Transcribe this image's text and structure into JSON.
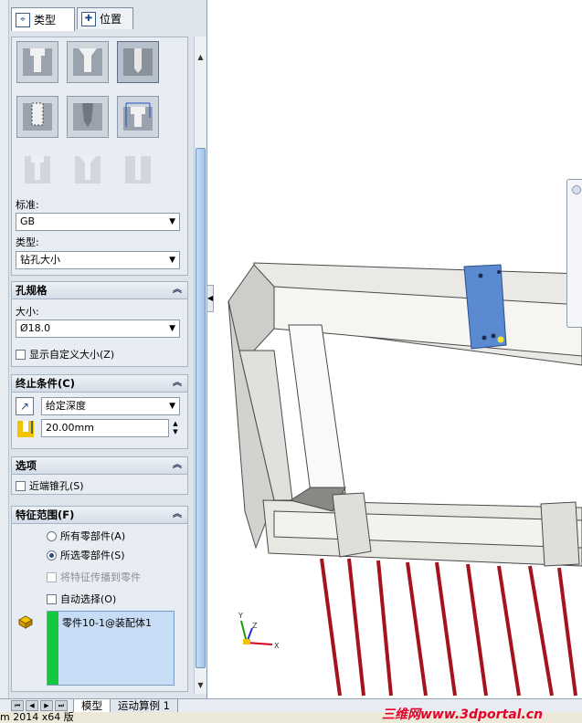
{
  "tabs": {
    "type_label": "类型",
    "position_label": "位置"
  },
  "hole_type": {
    "standard_label": "标准:",
    "standard_value": "GB",
    "type_label": "类型:",
    "type_value": "钻孔大小"
  },
  "hole_spec": {
    "title": "孔规格",
    "size_label": "大小:",
    "size_value": "Ø18.0",
    "custom_size_label": "显示自定义大小(Z)"
  },
  "end_condition": {
    "title": "终止条件(C)",
    "mode_value": "给定深度",
    "depth_value": "20.00mm"
  },
  "options": {
    "title": "选项",
    "near_side_csk_label": "近端锥孔(S)"
  },
  "feature_scope": {
    "title": "特征范围(F)",
    "all_parts_label": "所有零部件(A)",
    "selected_parts_label": "所选零部件(S)",
    "propagate_label": "将特征传播到零件",
    "auto_select_label": "自动选择(O)",
    "selected_item": "零件10-1@装配体1"
  },
  "bottom_tabs": {
    "model_label": "模型",
    "motion_label": "运动算例 1"
  },
  "status": {
    "version_text": "m 2014 x64 版"
  },
  "watermark": {
    "text": "三维网www.3dportal.cn"
  },
  "triad": {
    "x": "X",
    "y": "Y",
    "z": "Z"
  },
  "colors": {
    "accent_blue": "#1f4d8c",
    "panel_bg": "#dde4ec",
    "frame_gray": "#e9e7e2",
    "selected_part": "#5b8ad1",
    "pins_red": "#a5141c",
    "selection_green": "#16c540"
  }
}
